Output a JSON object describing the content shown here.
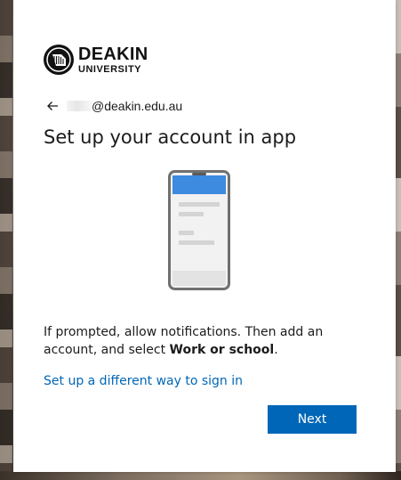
{
  "brand": {
    "line1": "DEAKIN",
    "line2": "UNIVERSITY"
  },
  "account": {
    "email_visible": "@deakin.edu.au"
  },
  "heading": "Set up your account in app",
  "description": {
    "prefix": "If prompted, allow notifications. Then add an account, and select ",
    "bold": "Work or school",
    "suffix": "."
  },
  "links": {
    "alternate_signin": "Set up a different way to sign in"
  },
  "buttons": {
    "next": "Next"
  },
  "icons": {
    "back": "back-arrow-icon",
    "logo": "deakin-logo-icon",
    "phone": "phone-illustration-icon"
  },
  "colors": {
    "accent": "#0067b8",
    "phone_frame": "#707070",
    "phone_header": "#3c8be0"
  }
}
